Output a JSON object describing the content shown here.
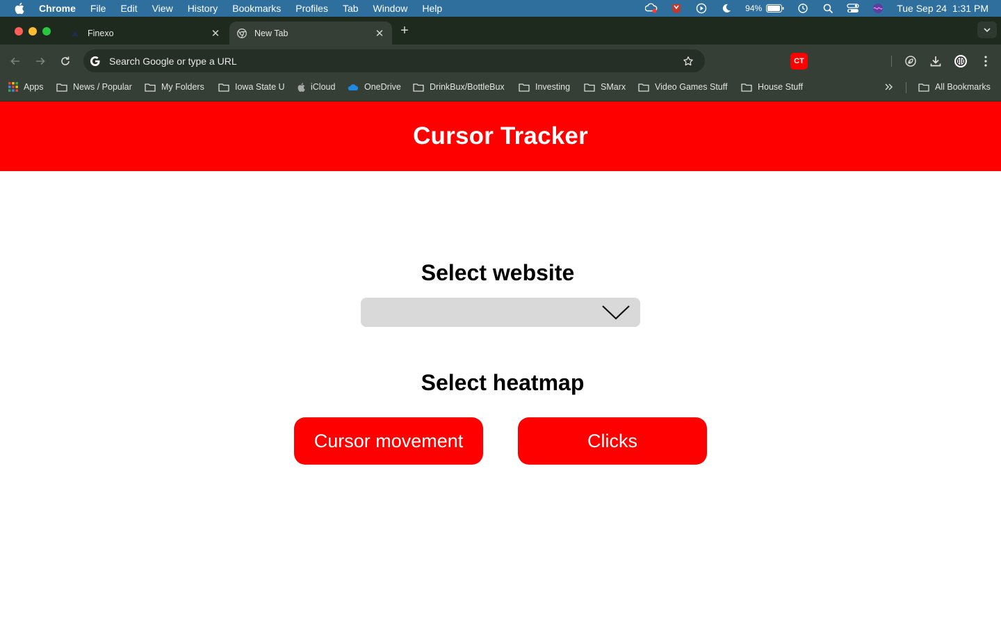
{
  "menubar": {
    "app_name": "Chrome",
    "items": [
      "File",
      "Edit",
      "View",
      "History",
      "Bookmarks",
      "Profiles",
      "Tab",
      "Window",
      "Help"
    ],
    "battery": "94%",
    "datetime": "Tue Sep 24  1:31 PM"
  },
  "tabs": [
    {
      "title": "Finexo",
      "favicon": "finexo-icon"
    },
    {
      "title": "New Tab",
      "favicon": "chrome-icon"
    }
  ],
  "omnibox": {
    "placeholder": "Search Google or type a URL"
  },
  "extension": {
    "label": "CT",
    "color": "#ff0000"
  },
  "bookmarks": {
    "items": [
      "Apps",
      "News / Popular",
      "My Folders",
      "Iowa State U",
      "iCloud",
      "OneDrive",
      "DrinkBux/BottleBux",
      "Investing",
      "SMarx",
      "Video Games Stuff",
      "House Stuff"
    ],
    "all_bookmarks": "All Bookmarks"
  },
  "page": {
    "title": "Cursor Tracker",
    "select_website_label": "Select website",
    "website_value": "",
    "select_heatmap_label": "Select heatmap",
    "buttons": {
      "cursor_movement": "Cursor movement",
      "clicks": "Clicks"
    },
    "accent_color": "#ff0000",
    "select_bg": "#d9d9d9"
  }
}
